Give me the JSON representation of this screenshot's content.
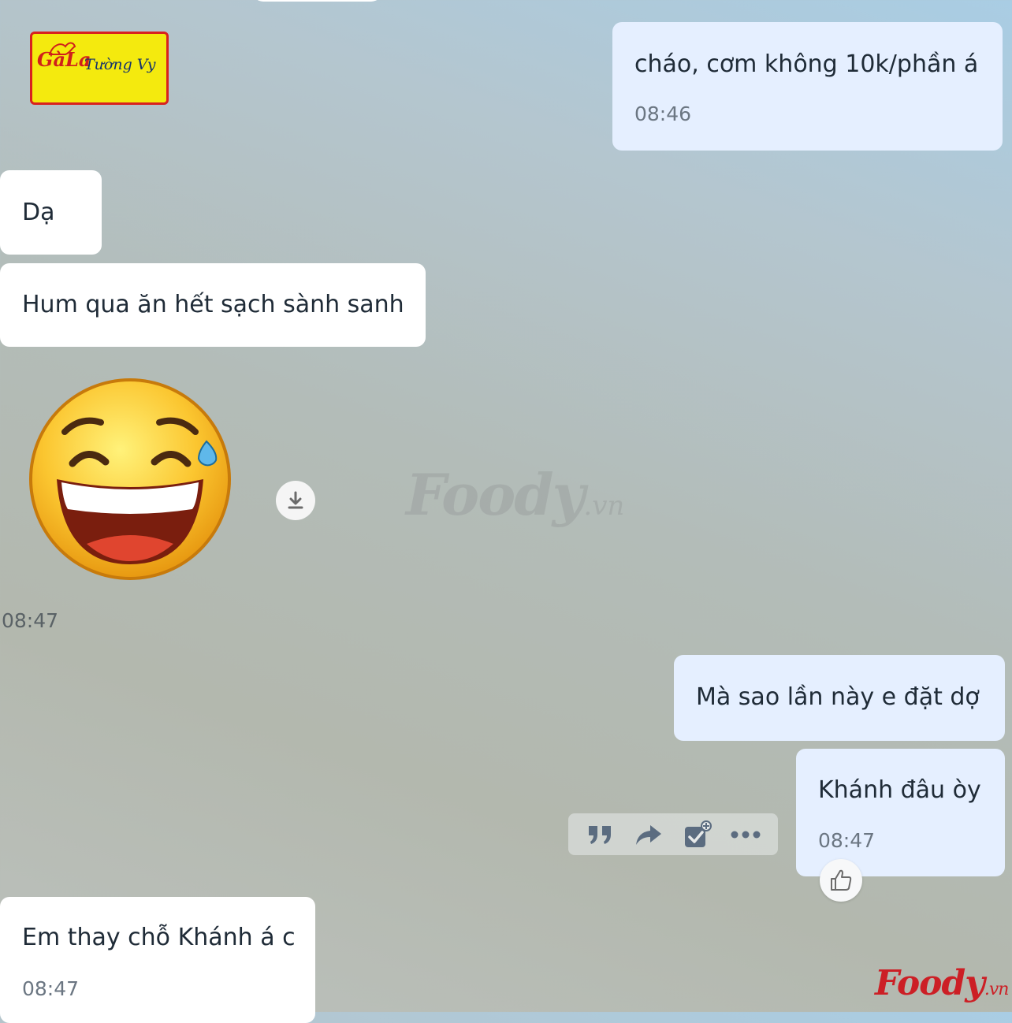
{
  "logo": {
    "mark_text": "GàLa",
    "name_text": "Tường Vy"
  },
  "messages": [
    {
      "side": "out",
      "text": "cháo, cơm không 10k/phần á",
      "time": "08:46"
    },
    {
      "side": "in",
      "text": "Dạ"
    },
    {
      "side": "in",
      "text": "Hum qua ăn hết sạch sành sanh"
    },
    {
      "side": "in",
      "kind": "sticker",
      "icon": "laughing-tears-sticker",
      "time": "08:47"
    },
    {
      "side": "out",
      "text": "Mà sao lần này e đặt dợ"
    },
    {
      "side": "out",
      "text": "Khánh đâu òy",
      "time": "08:47"
    },
    {
      "side": "in",
      "text": "Em thay chỗ Khánh á c",
      "time": "08:47"
    }
  ],
  "message_actions": [
    "quote-icon",
    "forward-icon",
    "mark-task-icon",
    "more-icon"
  ],
  "reaction": "thumbs-up-icon",
  "watermark": {
    "main": "Foody",
    "suffix": ".vn"
  },
  "brand": {
    "main": "Foody",
    "suffix": ".vn"
  },
  "colors": {
    "incoming_bubble": "#ffffff",
    "outgoing_bubble": "#e5efff",
    "brand_red": "#cc1f25"
  }
}
